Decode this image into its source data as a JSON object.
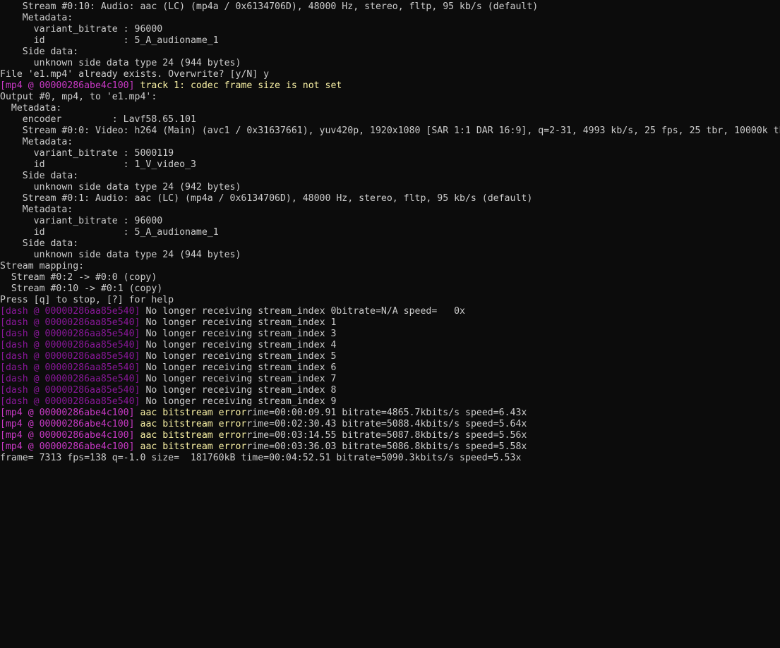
{
  "terminal": {
    "lines": [
      {
        "text": "    Stream #0:10: Audio: aac (LC) (mp4a / 0x6134706D), 48000 Hz, stereo, fltp, 95 kb/s (default)"
      },
      {
        "text": "    Metadata:"
      },
      {
        "text": "      variant_bitrate : 96000"
      },
      {
        "text": "      id              : 5_A_audioname_1"
      },
      {
        "text": "    Side data:"
      },
      {
        "text": "      unknown side data type 24 (944 bytes)"
      },
      {
        "text": "File 'e1.mp4' already exists. Overwrite? [y/N] y"
      },
      {
        "prefix": "[mp4 @ 00000286abe4c100]",
        "prefix_type": "mp4",
        "text": " track 1: codec frame size is not set",
        "text_type": "warn"
      },
      {
        "text": "Output #0, mp4, to 'e1.mp4':"
      },
      {
        "text": "  Metadata:"
      },
      {
        "text": "    encoder         : Lavf58.65.101"
      },
      {
        "text": "    Stream #0:0: Video: h264 (Main) (avc1 / 0x31637661), yuv420p, 1920x1080 [SAR 1:1 DAR 16:9], q=2-31, 4993 kb/s, 25 fps, 25 tbr, 10000k tbn, 25 tbc (default)"
      },
      {
        "text": "    Metadata:"
      },
      {
        "text": "      variant_bitrate : 5000119"
      },
      {
        "text": "      id              : 1_V_video_3"
      },
      {
        "text": "    Side data:"
      },
      {
        "text": "      unknown side data type 24 (942 bytes)"
      },
      {
        "text": "    Stream #0:1: Audio: aac (LC) (mp4a / 0x6134706D), 48000 Hz, stereo, fltp, 95 kb/s (default)"
      },
      {
        "text": "    Metadata:"
      },
      {
        "text": "      variant_bitrate : 96000"
      },
      {
        "text": "      id              : 5_A_audioname_1"
      },
      {
        "text": "    Side data:"
      },
      {
        "text": "      unknown side data type 24 (944 bytes)"
      },
      {
        "text": "Stream mapping:"
      },
      {
        "text": "  Stream #0:2 -> #0:0 (copy)"
      },
      {
        "text": "  Stream #0:10 -> #0:1 (copy)"
      },
      {
        "text": "Press [q] to stop, [?] for help"
      },
      {
        "prefix": "[dash @ 00000286aa85e540]",
        "prefix_type": "dash",
        "text": " No longer receiving stream_index 0bitrate=N/A speed=   0x"
      },
      {
        "prefix": "[dash @ 00000286aa85e540]",
        "prefix_type": "dash",
        "text": " No longer receiving stream_index 1"
      },
      {
        "prefix": "[dash @ 00000286aa85e540]",
        "prefix_type": "dash",
        "text": " No longer receiving stream_index 3"
      },
      {
        "prefix": "[dash @ 00000286aa85e540]",
        "prefix_type": "dash",
        "text": " No longer receiving stream_index 4"
      },
      {
        "prefix": "[dash @ 00000286aa85e540]",
        "prefix_type": "dash",
        "text": " No longer receiving stream_index 5"
      },
      {
        "prefix": "[dash @ 00000286aa85e540]",
        "prefix_type": "dash",
        "text": " No longer receiving stream_index 6"
      },
      {
        "prefix": "[dash @ 00000286aa85e540]",
        "prefix_type": "dash",
        "text": " No longer receiving stream_index 7"
      },
      {
        "prefix": "[dash @ 00000286aa85e540]",
        "prefix_type": "dash",
        "text": " No longer receiving stream_index 8"
      },
      {
        "prefix": "[dash @ 00000286aa85e540]",
        "prefix_type": "dash",
        "text": " No longer receiving stream_index 9"
      },
      {
        "prefix": "[mp4 @ 00000286abe4c100]",
        "prefix_type": "mp4",
        "warn": " aac bitstream error",
        "text": "rime=00:00:09.91 bitrate=4865.7kbits/s speed=6.43x"
      },
      {
        "prefix": "[mp4 @ 00000286abe4c100]",
        "prefix_type": "mp4",
        "warn": " aac bitstream error",
        "text": "rime=00:02:30.43 bitrate=5088.4kbits/s speed=5.64x"
      },
      {
        "prefix": "[mp4 @ 00000286abe4c100]",
        "prefix_type": "mp4",
        "warn": " aac bitstream error",
        "text": "rime=00:03:14.55 bitrate=5087.8kbits/s speed=5.56x"
      },
      {
        "prefix": "[mp4 @ 00000286abe4c100]",
        "prefix_type": "mp4",
        "warn": " aac bitstream error",
        "text": "rime=00:03:36.03 bitrate=5086.8kbits/s speed=5.58x"
      },
      {
        "text": "frame= 7313 fps=138 q=-1.0 size=  181760kB time=00:04:52.51 bitrate=5090.3kbits/s speed=5.53x"
      }
    ]
  }
}
